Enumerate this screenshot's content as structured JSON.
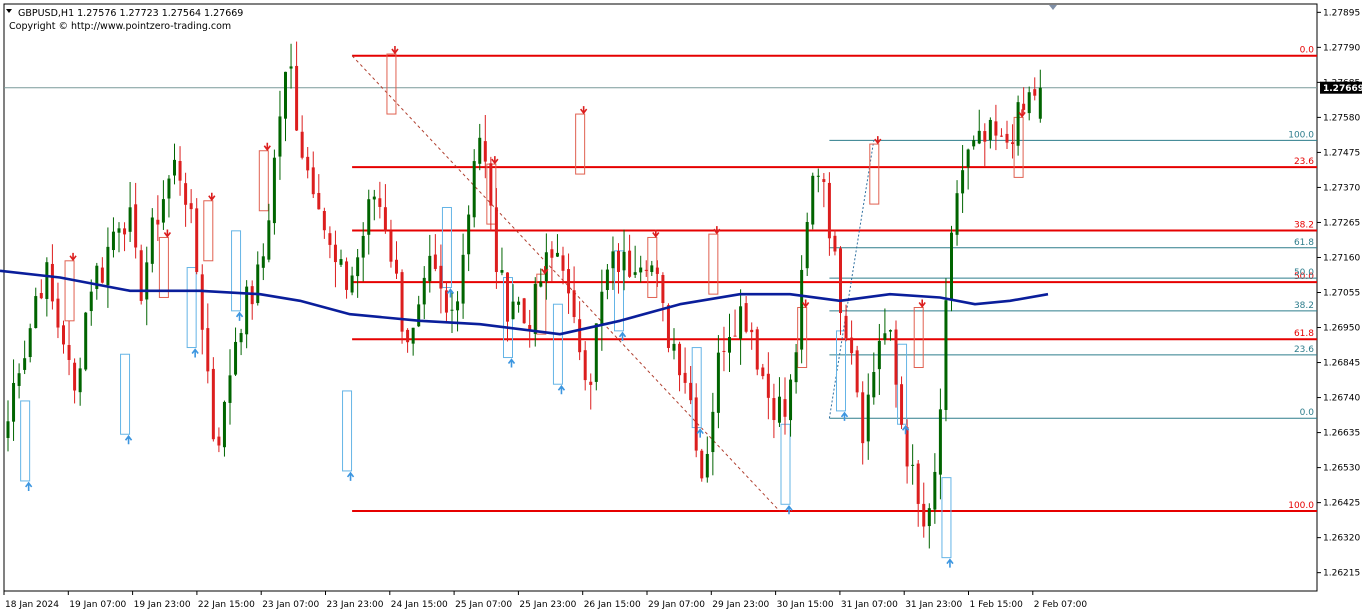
{
  "header": {
    "symbol_line": "GBPUSD,H1  1.27576 1.27723 1.27564 1.27669",
    "copyright": "Copyright © http://www.pointzero-trading.com"
  },
  "current_price": "1.27669",
  "colors": {
    "bull": "#006400",
    "bear": "#dc1e1e",
    "ma": "#0a1e9b",
    "fib_red": "#e60000",
    "fib_teal": "#2e7d8c",
    "swing_high_box": "#e06050",
    "swing_low_box": "#64b4e6",
    "price_line": "#7a9a9a"
  },
  "chart_data": {
    "type": "candlestick",
    "ylim": [
      1.2616,
      1.2792
    ],
    "y_ticks": [
      "1.27895",
      "1.27790",
      "1.27685",
      "1.27580",
      "1.27475",
      "1.27370",
      "1.27265",
      "1.27160",
      "1.27055",
      "1.26950",
      "1.26845",
      "1.26740",
      "1.26635",
      "1.26530",
      "1.26425",
      "1.26320",
      "1.26215"
    ],
    "x_ticks": [
      "18 Jan 2024",
      "19 Jan 07:00",
      "19 Jan 23:00",
      "22 Jan 15:00",
      "23 Jan 07:00",
      "23 Jan 23:00",
      "24 Jan 15:00",
      "25 Jan 07:00",
      "25 Jan 23:00",
      "26 Jan 15:00",
      "29 Jan 07:00",
      "29 Jan 23:00",
      "30 Jan 15:00",
      "31 Jan 07:00",
      "31 Jan 23:00",
      "1 Feb 15:00",
      "2 Feb 07:00"
    ],
    "ohlc_anchor_closes": [
      1.2667,
      1.2685,
      1.269,
      1.2705,
      1.2712,
      1.2698,
      1.2692,
      1.2672,
      1.2695,
      1.2711,
      1.2712,
      1.2722,
      1.273,
      1.2726,
      1.2705,
      1.2718,
      1.273,
      1.2738,
      1.2745,
      1.2735,
      1.2715,
      1.269,
      1.266,
      1.2668,
      1.269,
      1.27,
      1.2705,
      1.2712,
      1.2735,
      1.276,
      1.2775,
      1.2753,
      1.2742,
      1.2738,
      1.272,
      1.2712,
      1.2708,
      1.2713,
      1.2725,
      1.2735,
      1.273,
      1.2715,
      1.2698,
      1.269,
      1.27,
      1.2712,
      1.2705,
      1.2695,
      1.271,
      1.2728,
      1.2758,
      1.274,
      1.2715,
      1.2702,
      1.2705,
      1.2697,
      1.27,
      1.2712,
      1.2715,
      1.272,
      1.2695,
      1.269,
      1.268,
      1.27,
      1.2712,
      1.2715,
      1.2713,
      1.2718,
      1.2718,
      1.271,
      1.2695,
      1.269,
      1.2683,
      1.267,
      1.265,
      1.267,
      1.269,
      1.2697,
      1.27,
      1.2698,
      1.2685,
      1.2675,
      1.2672,
      1.2668,
      1.269,
      1.272,
      1.2745,
      1.274,
      1.2715,
      1.27,
      1.269,
      1.2665,
      1.2678,
      1.2695,
      1.269,
      1.267,
      1.2655,
      1.264,
      1.2632,
      1.2655,
      1.27,
      1.2735,
      1.2745,
      1.2748,
      1.275,
      1.2752,
      1.2748,
      1.2755,
      1.2758,
      1.2765,
      1.2767
    ],
    "last_ohlc": {
      "open": 1.27576,
      "high": 1.27723,
      "low": 1.27564,
      "close": 1.27669
    },
    "moving_average": [
      {
        "x": 0,
        "y": 1.2712
      },
      {
        "x": 60,
        "y": 1.271
      },
      {
        "x": 130,
        "y": 1.2706
      },
      {
        "x": 200,
        "y": 1.2706
      },
      {
        "x": 260,
        "y": 1.2705
      },
      {
        "x": 300,
        "y": 1.2703
      },
      {
        "x": 350,
        "y": 1.2699
      },
      {
        "x": 420,
        "y": 1.2697
      },
      {
        "x": 480,
        "y": 1.2696
      },
      {
        "x": 560,
        "y": 1.2693
      },
      {
        "x": 620,
        "y": 1.2697
      },
      {
        "x": 680,
        "y": 1.2702
      },
      {
        "x": 740,
        "y": 1.2705
      },
      {
        "x": 790,
        "y": 1.2705
      },
      {
        "x": 840,
        "y": 1.2703
      },
      {
        "x": 890,
        "y": 1.2705
      },
      {
        "x": 940,
        "y": 1.2704
      },
      {
        "x": 975,
        "y": 1.2702
      },
      {
        "x": 1010,
        "y": 1.2703
      },
      {
        "x": 1048,
        "y": 1.2705
      }
    ],
    "fib_sets": [
      {
        "name": "red",
        "color": "#e60000",
        "start_candle": 62,
        "levels": [
          {
            "label": "0.0",
            "price": 1.27765
          },
          {
            "label": "23.6",
            "price": 1.27431
          },
          {
            "label": "38.2",
            "price": 1.27241
          },
          {
            "label": "50.0",
            "price": 1.27086
          },
          {
            "label": "61.8",
            "price": 1.26915
          },
          {
            "label": "100.0",
            "price": 1.264
          }
        ]
      },
      {
        "name": "teal",
        "color": "#2e7d8c",
        "start_candle": 148,
        "levels": [
          {
            "label": "100.0",
            "price": 1.27511
          },
          {
            "label": "61.8",
            "price": 1.27189
          },
          {
            "label": "50.0",
            "price": 1.27098
          },
          {
            "label": "38.2",
            "price": 1.27
          },
          {
            "label": "23.6",
            "price": 1.26868
          },
          {
            "label": "0.0",
            "price": 1.26678
          }
        ]
      }
    ],
    "swing_highs": [
      {
        "candle": 11,
        "price": 1.2715
      },
      {
        "candle": 28,
        "price": 1.2722
      },
      {
        "candle": 36,
        "price": 1.2733
      },
      {
        "candle": 46,
        "price": 1.2748
      },
      {
        "candle": 69,
        "price": 1.2777
      },
      {
        "candle": 87,
        "price": 1.2744
      },
      {
        "candle": 96,
        "price": 1.2711
      },
      {
        "candle": 103,
        "price": 1.2759
      },
      {
        "candle": 116,
        "price": 1.2722
      },
      {
        "candle": 127,
        "price": 1.2723
      },
      {
        "candle": 143,
        "price": 1.2701
      },
      {
        "candle": 156,
        "price": 1.275
      },
      {
        "candle": 164,
        "price": 1.2701
      },
      {
        "candle": 182,
        "price": 1.2758
      }
    ],
    "swing_lows": [
      {
        "candle": 3,
        "price": 1.2649
      },
      {
        "candle": 21,
        "price": 1.2663
      },
      {
        "candle": 33,
        "price": 1.2689
      },
      {
        "candle": 41,
        "price": 1.27
      },
      {
        "candle": 61,
        "price": 1.2652
      },
      {
        "candle": 79,
        "price": 1.2707
      },
      {
        "candle": 90,
        "price": 1.2686
      },
      {
        "candle": 99,
        "price": 1.2678
      },
      {
        "candle": 110,
        "price": 1.2694
      },
      {
        "candle": 124,
        "price": 1.2665
      },
      {
        "candle": 140,
        "price": 1.2642
      },
      {
        "candle": 150,
        "price": 1.267
      },
      {
        "candle": 161,
        "price": 1.2666
      },
      {
        "candle": 169,
        "price": 1.2626
      }
    ]
  }
}
